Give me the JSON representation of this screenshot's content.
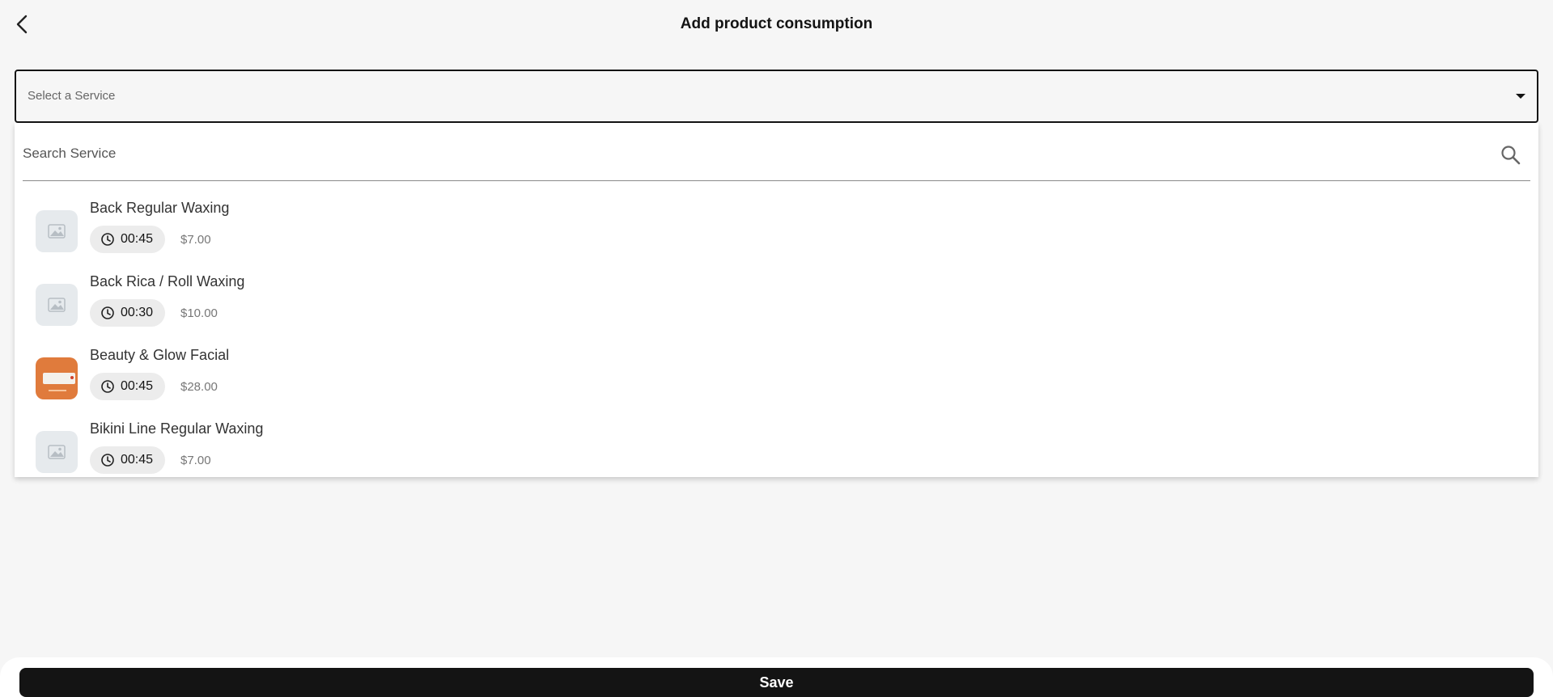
{
  "header": {
    "title": "Add product consumption",
    "back_icon": "chevron-left-icon"
  },
  "service_select": {
    "placeholder": "Select a Service",
    "icon": "caret-down-icon"
  },
  "search": {
    "placeholder": "Search Service",
    "icon": "search-icon"
  },
  "services": [
    {
      "name": "Back Regular Waxing",
      "duration": "00:45",
      "price": "$7.00",
      "image": "placeholder-image-icon"
    },
    {
      "name": "Back Rica / Roll Waxing",
      "duration": "00:30",
      "price": "$10.00",
      "image": "placeholder-image-icon"
    },
    {
      "name": "Beauty & Glow Facial",
      "duration": "00:45",
      "price": "$28.00",
      "image": "product-photo"
    },
    {
      "name": "Bikini Line Regular Waxing",
      "duration": "00:45",
      "price": "$7.00",
      "image": "placeholder-image-icon"
    }
  ],
  "footer": {
    "save_label": "Save"
  },
  "colors": {
    "background": "#f6f6f6",
    "primary": "#141414",
    "photo_accent": "#e07b3c"
  }
}
